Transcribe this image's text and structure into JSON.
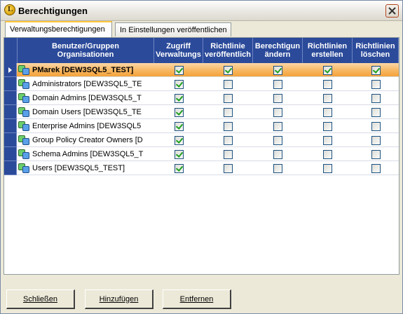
{
  "window": {
    "title": "Berechtigungen"
  },
  "tabs": [
    {
      "label": "Verwaltungsberechtigungen",
      "active": true
    },
    {
      "label": "In Einstellungen veröffentlichen",
      "active": false
    }
  ],
  "grid": {
    "columns": [
      "Benutzer/Gruppen\nOrganisationen",
      "Zugriff\nVerwaltungs",
      "Richtlinie\nveröffentlich",
      "Berechtigun\nändern",
      "Richtlinien\nerstellen",
      "Richtlinien\nlöschen"
    ],
    "rows": [
      {
        "name": "PMarek [DEW3SQL5_TEST]",
        "selected": true,
        "checks": [
          true,
          true,
          true,
          true,
          true
        ]
      },
      {
        "name": "Administrators [DEW3SQL5_TE",
        "selected": false,
        "checks": [
          true,
          false,
          false,
          false,
          false
        ]
      },
      {
        "name": "Domain Admins [DEW3SQL5_T",
        "selected": false,
        "checks": [
          true,
          false,
          false,
          false,
          false
        ]
      },
      {
        "name": "Domain Users [DEW3SQL5_TE",
        "selected": false,
        "checks": [
          true,
          false,
          false,
          false,
          false
        ]
      },
      {
        "name": "Enterprise Admins [DEW3SQL5",
        "selected": false,
        "checks": [
          true,
          false,
          false,
          false,
          false
        ]
      },
      {
        "name": "Group Policy Creator Owners [D",
        "selected": false,
        "checks": [
          true,
          false,
          false,
          false,
          false
        ]
      },
      {
        "name": "Schema Admins [DEW3SQL5_T",
        "selected": false,
        "checks": [
          true,
          false,
          false,
          false,
          false
        ]
      },
      {
        "name": "Users [DEW3SQL5_TEST]",
        "selected": false,
        "checks": [
          true,
          false,
          false,
          false,
          false
        ]
      }
    ]
  },
  "buttons": {
    "close": "Schließen",
    "add": "Hinzufügen",
    "remove": "Entfernen"
  },
  "colors": {
    "header": "#2b4a9a",
    "selected_row": "#f7b45c",
    "check": "#21a121"
  },
  "icons": {
    "window_close": "close-icon",
    "app": "app-icon",
    "group": "group-icon",
    "row_pointer": "arrow-right-icon"
  }
}
